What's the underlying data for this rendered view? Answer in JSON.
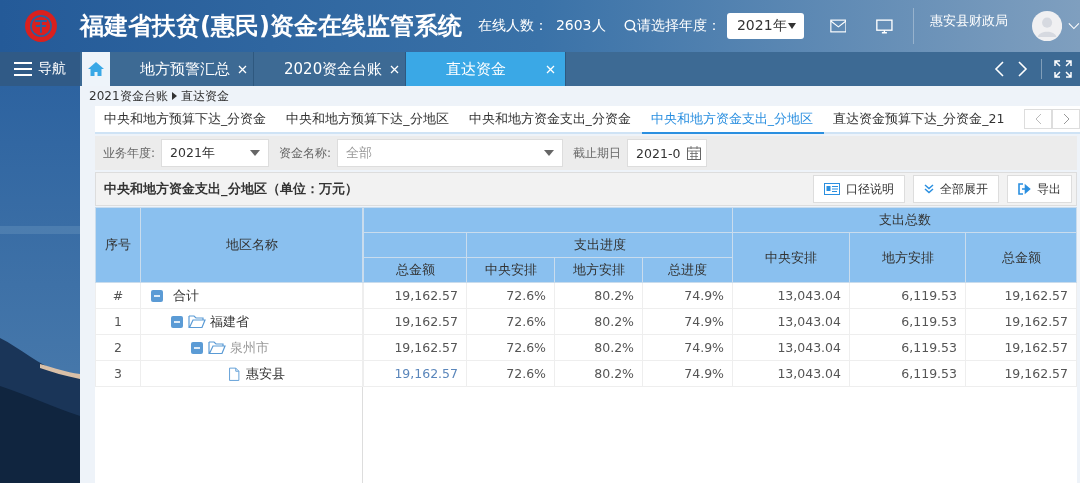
{
  "app": {
    "title": "福建省扶贫(惠民)资金在线监管系统",
    "online_label": "在线人数：",
    "online_count": "2603人",
    "year_label": "请选择年度：",
    "year": "2021年",
    "user": "惠安县财政局"
  },
  "nav": {
    "label": "导航"
  },
  "tabs": [
    {
      "label": "地方预警汇总",
      "selected": false
    },
    {
      "label": "2020资金台账",
      "selected": false
    },
    {
      "label": "直达资金",
      "selected": true
    }
  ],
  "breadcrumb": [
    "2021资金台账",
    "直达资金"
  ],
  "sub_tabs": [
    {
      "label": "中央和地方预算下达_分资金",
      "selected": false
    },
    {
      "label": "中央和地方预算下达_分地区",
      "selected": false
    },
    {
      "label": "中央和地方资金支出_分资金",
      "selected": false
    },
    {
      "label": "中央和地方资金支出_分地区",
      "selected": true
    },
    {
      "label": "直达资金预算下达_分资金_21",
      "selected": false
    }
  ],
  "filters": {
    "year_label": "业务年度:",
    "year": "2021年",
    "fund_label": "资金名称:",
    "fund": "全部",
    "date_label": "截止期日",
    "date": "2021-0"
  },
  "panel": {
    "title": "中央和地方资金支出_分地区（单位：万元）",
    "buttons": [
      {
        "kind": "info",
        "label": "口径说明"
      },
      {
        "kind": "expand",
        "label": "全部展开"
      },
      {
        "kind": "export",
        "label": "导出"
      }
    ]
  },
  "table": {
    "header": {
      "index": "序号",
      "region": "地区名称",
      "progress_group": "支出进度",
      "total_group": "支出总数",
      "columns": [
        "总金额",
        "中央安排",
        "地方安排",
        "总进度",
        "中央安排",
        "地方安排",
        "总金额"
      ]
    },
    "rows": [
      {
        "index": "#",
        "name": "合计",
        "kind": "total",
        "expanded": true,
        "dimmed": false,
        "linked": false,
        "values": [
          "19,162.57",
          "72.6%",
          "80.2%",
          "74.9%",
          "13,043.04",
          "6,119.53",
          "19,162.57"
        ],
        "children": [
          {
            "index": "1",
            "name": "福建省",
            "kind": "folder",
            "expanded": true,
            "dimmed": false,
            "linked": false,
            "values": [
              "19,162.57",
              "72.6%",
              "80.2%",
              "74.9%",
              "13,043.04",
              "6,119.53",
              "19,162.57"
            ],
            "children": [
              {
                "index": "2",
                "name": "泉州市",
                "kind": "folder",
                "expanded": true,
                "dimmed": true,
                "linked": false,
                "values": [
                  "19,162.57",
                  "72.6%",
                  "80.2%",
                  "74.9%",
                  "13,043.04",
                  "6,119.53",
                  "19,162.57"
                ],
                "children": [
                  {
                    "index": "3",
                    "name": "惠安县",
                    "kind": "leaf",
                    "dimmed": false,
                    "linked": true,
                    "values": [
                      "19,162.57",
                      "72.6%",
                      "80.2%",
                      "74.9%",
                      "13,043.04",
                      "6,119.53",
                      "19,162.57"
                    ]
                  }
                ]
              }
            ]
          }
        ]
      }
    ]
  }
}
